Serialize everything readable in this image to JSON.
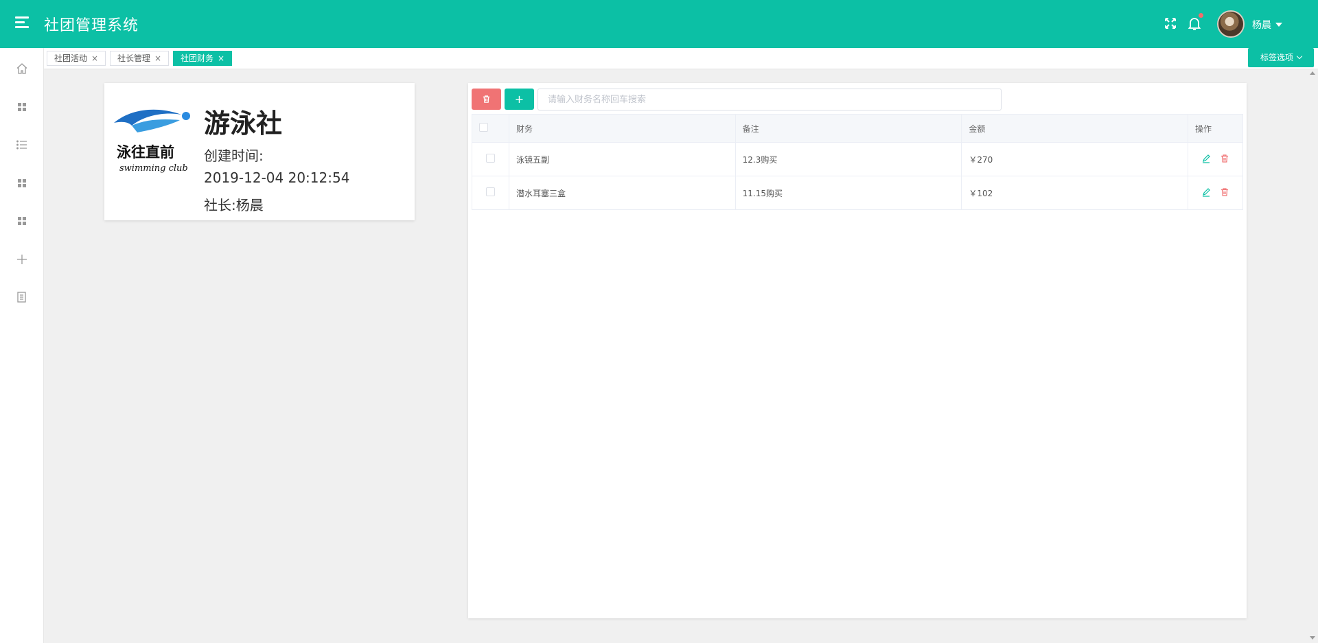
{
  "app": {
    "title": "社团管理系统"
  },
  "header": {
    "user_name": "杨晨",
    "icons": [
      "fullscreen-icon",
      "bell-icon"
    ]
  },
  "sidebar": {
    "items": [
      {
        "icon": "home-icon"
      },
      {
        "icon": "grid-icon"
      },
      {
        "icon": "list-icon"
      },
      {
        "icon": "grid-icon"
      },
      {
        "icon": "grid-icon"
      },
      {
        "icon": "plus-icon"
      },
      {
        "icon": "document-icon"
      }
    ]
  },
  "tabs": {
    "items": [
      {
        "label": "社团活动",
        "active": false
      },
      {
        "label": "社长管理",
        "active": false
      },
      {
        "label": "社团财务",
        "active": true
      }
    ],
    "close_glyph": "×",
    "options_label": "标签选项"
  },
  "club": {
    "logo_text": "泳往直前",
    "logo_subtext": "swimming club",
    "name": "游泳社",
    "created_label": "创建时间:",
    "created_at": "2019-12-04 20:12:54",
    "leader": "社长:杨晨"
  },
  "finance": {
    "search_placeholder": "请输入财务名称回车搜索",
    "search_value": "",
    "add_glyph": "+",
    "columns": [
      "财务",
      "备注",
      "金额",
      "操作"
    ],
    "rows": [
      {
        "name": "泳镜五副",
        "note": "12.3购买",
        "amount": "￥270"
      },
      {
        "name": "潜水耳塞三盒",
        "note": "11.15购买",
        "amount": "￥102"
      }
    ]
  },
  "colors": {
    "primary": "#0cc0a5",
    "danger": "#f07374",
    "background": "#f0f0f0"
  }
}
